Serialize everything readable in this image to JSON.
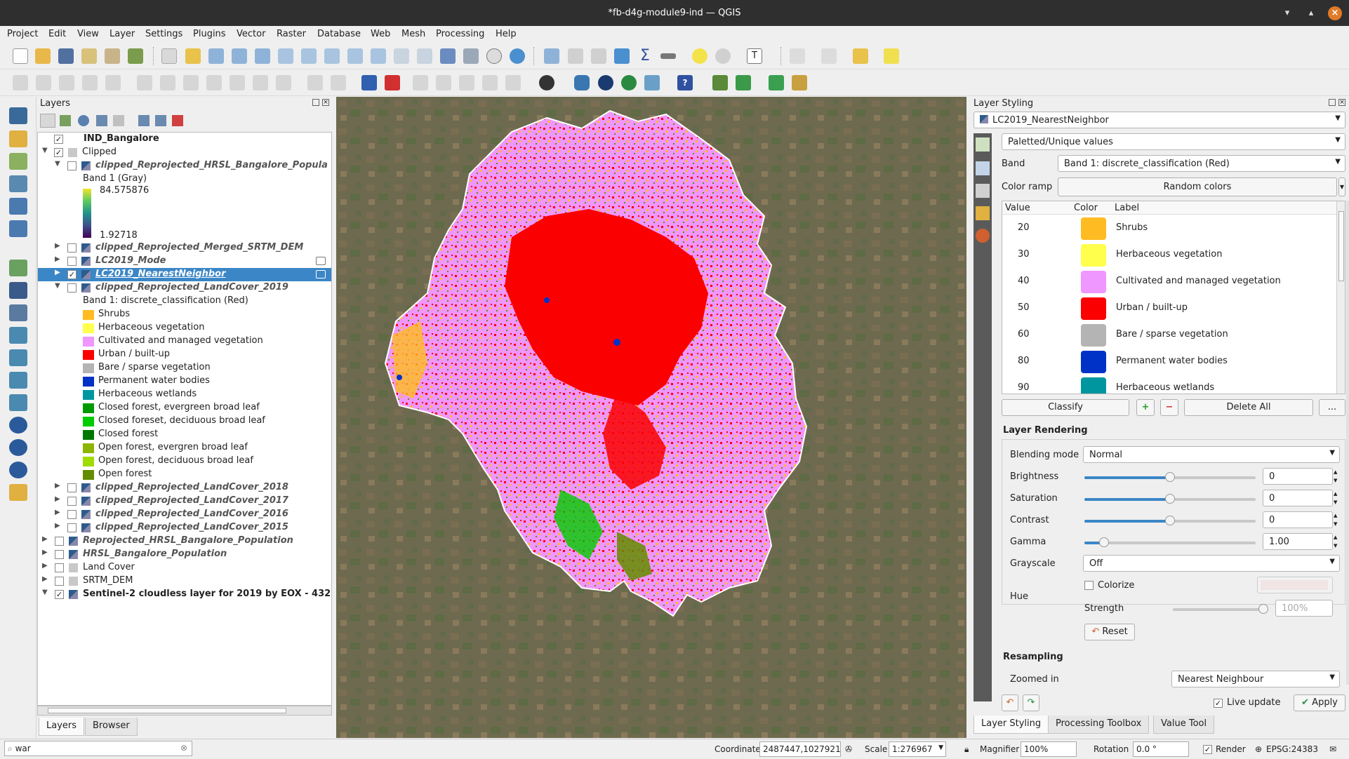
{
  "window": {
    "title": "*fb-d4g-module9-ind — QGIS"
  },
  "menu": [
    "Project",
    "Edit",
    "View",
    "Layer",
    "Settings",
    "Plugins",
    "Vector",
    "Raster",
    "Database",
    "Web",
    "Mesh",
    "Processing",
    "Help"
  ],
  "layers_panel": {
    "title": "Layers",
    "tree": [
      {
        "label": "IND_Bangalore",
        "checked": true,
        "style": "bold",
        "indent": 0,
        "expander": "none"
      },
      {
        "label": "Clipped",
        "checked": true,
        "style": "normal",
        "indent": 0,
        "expander": "open",
        "group": true
      },
      {
        "label": "clipped_Reprojected_HRSL_Bangalore_Popula",
        "checked": false,
        "style": "italic",
        "indent": 1,
        "expander": "open"
      },
      {
        "label": "Band 1 (Gray)",
        "type": "legend-text",
        "indent": 2
      },
      {
        "label": "clipped_Reprojected_Merged_SRTM_DEM",
        "checked": false,
        "style": "italic",
        "indent": 1,
        "expander": "closed"
      },
      {
        "label": "LC2019_Mode",
        "checked": false,
        "style": "italic",
        "indent": 1,
        "expander": "closed"
      },
      {
        "label": "LC2019_NearestNeighbor",
        "checked": true,
        "style": "bold-italic",
        "indent": 1,
        "expander": "closed",
        "selected": true
      },
      {
        "label": "clipped_Reprojected_LandCover_2019",
        "checked": false,
        "style": "italic",
        "indent": 1,
        "expander": "open"
      },
      {
        "label": "Band 1: discrete_classification (Red)",
        "type": "legend-text",
        "indent": 2
      }
    ],
    "gradient": {
      "max": "84.575876",
      "min": "1.92718"
    },
    "legend_classes": [
      {
        "label": "Shrubs",
        "color": "#FFBB22"
      },
      {
        "label": "Herbaceous vegetation",
        "color": "#FFFF4C"
      },
      {
        "label": "Cultivated and managed vegetation",
        "color": "#F096FF"
      },
      {
        "label": "Urban / built-up",
        "color": "#FA0000"
      },
      {
        "label": "Bare / sparse vegetation",
        "color": "#B4B4B4"
      },
      {
        "label": "Permanent water bodies",
        "color": "#0032C8"
      },
      {
        "label": "Herbaceous wetlands",
        "color": "#0096A0"
      },
      {
        "label": "Closed forest, evergreen broad leaf",
        "color": "#009900"
      },
      {
        "label": "Closed foreset, deciduous broad leaf",
        "color": "#00CC00"
      },
      {
        "label": "Closed forest",
        "color": "#007800"
      },
      {
        "label": "Open forest, evergren broad leaf",
        "color": "#8DB400"
      },
      {
        "label": "Open forest, deciduous broad leaf",
        "color": "#A0DC00"
      },
      {
        "label": "Open forest",
        "color": "#648C00"
      }
    ],
    "tree_bottom": [
      {
        "label": "clipped_Reprojected_LandCover_2018",
        "checked": false,
        "style": "italic",
        "indent": 1
      },
      {
        "label": "clipped_Reprojected_LandCover_2017",
        "checked": false,
        "style": "italic",
        "indent": 1
      },
      {
        "label": "clipped_Reprojected_LandCover_2016",
        "checked": false,
        "style": "italic",
        "indent": 1
      },
      {
        "label": "clipped_Reprojected_LandCover_2015",
        "checked": false,
        "style": "italic",
        "indent": 1
      },
      {
        "label": "Reprojected_HRSL_Bangalore_Population",
        "checked": false,
        "style": "italic",
        "indent": 0
      },
      {
        "label": "HRSL_Bangalore_Population",
        "checked": false,
        "style": "italic",
        "indent": 0
      },
      {
        "label": "Land Cover",
        "checked": false,
        "style": "normal",
        "indent": 0,
        "group": true
      },
      {
        "label": "SRTM_DEM",
        "checked": false,
        "style": "normal",
        "indent": 0,
        "group": true
      },
      {
        "label": "Sentinel-2 cloudless layer for 2019 by EOX - 432",
        "checked": true,
        "style": "bold",
        "indent": 0,
        "expander": "open"
      }
    ],
    "tabs": [
      "Layers",
      "Browser"
    ],
    "active_tab": "Layers"
  },
  "styling": {
    "title": "Layer Styling",
    "layer": "LC2019_NearestNeighbor",
    "renderer": "Paletted/Unique values",
    "band_label": "Band",
    "band_value": "Band 1: discrete_classification (Red)",
    "ramp_label": "Color ramp",
    "ramp_value": "Random colors",
    "table_headers": [
      "Value",
      "Color",
      "Label"
    ],
    "classes": [
      {
        "value": "20",
        "color": "#FFBB22",
        "label": "Shrubs"
      },
      {
        "value": "30",
        "color": "#FFFF4C",
        "label": "Herbaceous vegetation"
      },
      {
        "value": "40",
        "color": "#F096FF",
        "label": "Cultivated and managed vegetation"
      },
      {
        "value": "50",
        "color": "#FA0000",
        "label": "Urban / built-up"
      },
      {
        "value": "60",
        "color": "#B4B4B4",
        "label": "Bare / sparse vegetation"
      },
      {
        "value": "80",
        "color": "#0032C8",
        "label": "Permanent water bodies"
      },
      {
        "value": "90",
        "color": "#0096A0",
        "label": "Herbaceous wetlands"
      }
    ],
    "classify": "Classify",
    "delete_all": "Delete All",
    "more": "...",
    "rendering_title": "Layer Rendering",
    "blending_label": "Blending mode",
    "blending_value": "Normal",
    "brightness_label": "Brightness",
    "brightness_value": "0",
    "saturation_label": "Saturation",
    "saturation_value": "0",
    "contrast_label": "Contrast",
    "contrast_value": "0",
    "gamma_label": "Gamma",
    "gamma_value": "1.00",
    "grayscale_label": "Grayscale",
    "grayscale_value": "Off",
    "hue_label": "Hue",
    "colorize_label": "Colorize",
    "strength_label": "Strength",
    "strength_value": "100%",
    "reset_label": "Reset",
    "resampling_title": "Resampling",
    "zoomed_in_label": "Zoomed in",
    "zoomed_in_value": "Nearest Neighbour",
    "live_update": "Live update",
    "apply": "Apply",
    "tabs": [
      "Layer Styling",
      "Processing Toolbox",
      "Value Tool"
    ]
  },
  "status": {
    "search_value": "war",
    "coordinate_label": "Coordinate",
    "coordinate_value": "2487447,1027921",
    "scale_label": "Scale",
    "scale_value": "1:276967",
    "magnifier_label": "Magnifier",
    "magnifier_value": "100%",
    "rotation_label": "Rotation",
    "rotation_value": "0.0 °",
    "render_label": "Render",
    "crs": "EPSG:24383"
  }
}
